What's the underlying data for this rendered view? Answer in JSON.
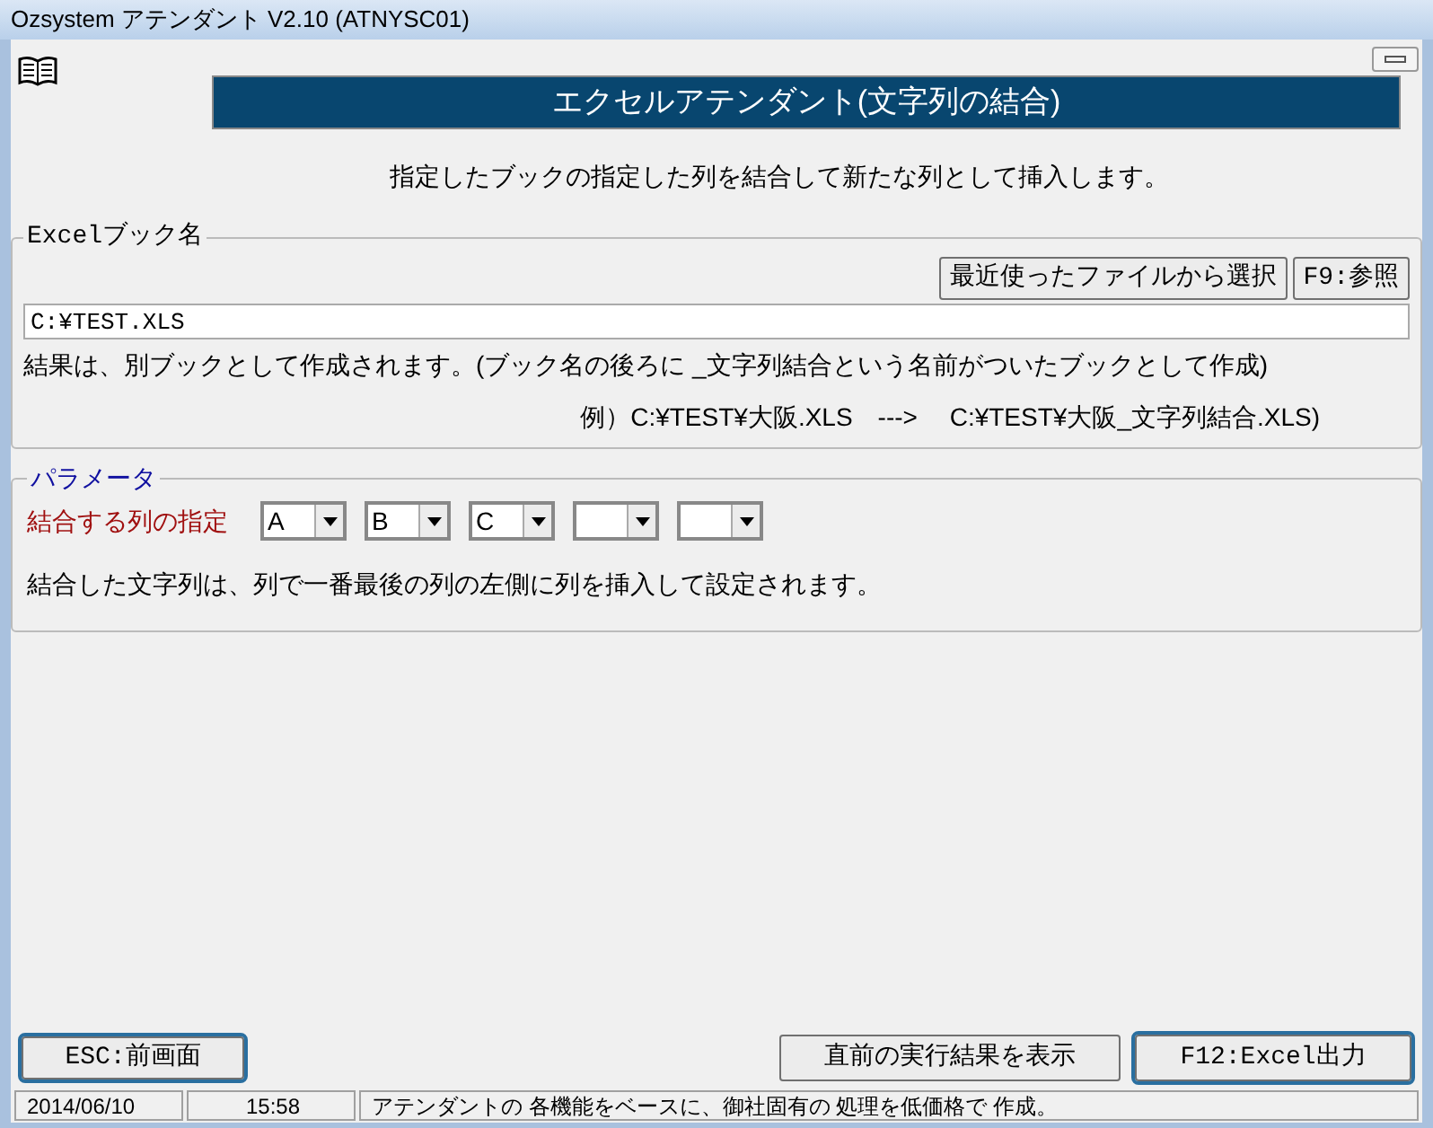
{
  "window": {
    "title": "Ozsystem アテンダント V2.10 (ATNYSC01)"
  },
  "header": {
    "title": "エクセルアテンダント(文字列の結合)"
  },
  "description": "指定したブックの指定した列を結合して新たな列として挿入します。",
  "excel_book": {
    "legend": "Excelブック名",
    "buttons": [
      "最近使ったファイルから選択",
      "F9:参照"
    ],
    "path": {
      "value": "C:¥TEST.XLS"
    },
    "note": "結果は、別ブックとして作成されます。(ブック名の後ろに _文字列結合という名前がついたブックとして作成)",
    "example": "例）C:¥TEST¥大阪.XLS　---> 　C:¥TEST¥大阪_文字列結合.XLS)"
  },
  "parameters": {
    "legend": "パラメータ",
    "label": "結合する列の指定",
    "column_selects": [
      {
        "value": "A",
        "empty": false
      },
      {
        "value": "B",
        "empty": false
      },
      {
        "value": "C",
        "empty": false
      },
      {
        "empty": true
      },
      {
        "empty": true
      }
    ],
    "note": "結合した文字列は、列で一番最後の列の左側に列を挿入して設定されます。"
  },
  "footer_buttons": [
    {
      "label": "ESC:前画面",
      "default": true
    },
    {
      "label": "直前の実行結果を表示",
      "default": false
    },
    {
      "label": "F12:Excel出力",
      "default": true
    }
  ],
  "status_bar": [
    "2014/06/10",
    "15:58",
    "アテンダントの 各機能をベースに、御社固有の 処理を低価格で 作成。"
  ]
}
